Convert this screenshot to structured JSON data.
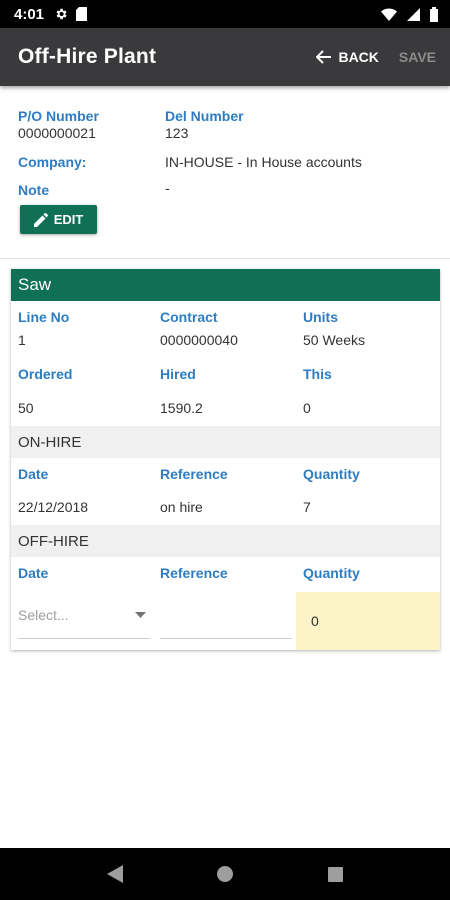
{
  "status_bar": {
    "time": "4:01"
  },
  "app_bar": {
    "title": "Off-Hire Plant",
    "back_label": "BACK",
    "save_label": "SAVE"
  },
  "header": {
    "po_label": "P/O Number",
    "po_value": "0000000021",
    "del_label": "Del Number",
    "del_value": "123",
    "company_label": "Company:",
    "company_value": "IN-HOUSE - In House accounts",
    "note_label": "Note",
    "note_value": "-",
    "edit_label": "EDIT"
  },
  "card": {
    "title": "Saw",
    "line_no_label": "Line No",
    "line_no_value": "1",
    "contract_label": "Contract",
    "contract_value": "0000000040",
    "units_label": "Units",
    "units_value": "50 Weeks",
    "ordered_label": "Ordered",
    "ordered_value": "50",
    "hired_label": "Hired",
    "hired_value": "1590.2",
    "this_label": "This",
    "this_value": "0",
    "on_hire": {
      "heading": "ON-HIRE",
      "date_label": "Date",
      "reference_label": "Reference",
      "quantity_label": "Quantity",
      "date_value": "22/12/2018",
      "reference_value": "on hire",
      "quantity_value": "7"
    },
    "off_hire": {
      "heading": "OFF-HIRE",
      "date_label": "Date",
      "reference_label": "Reference",
      "quantity_label": "Quantity",
      "date_placeholder": "Select...",
      "quantity_value": "0"
    }
  },
  "colors": {
    "accent_green": "#0f7055",
    "label_blue": "#2e7dc2",
    "app_bar": "#3a3a3d",
    "highlight": "#fcf4c6"
  }
}
